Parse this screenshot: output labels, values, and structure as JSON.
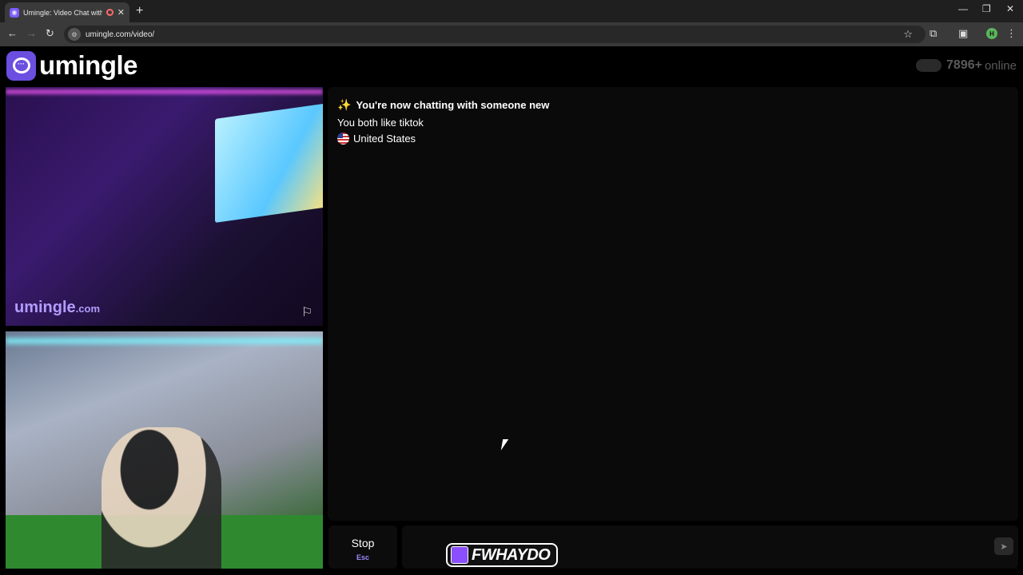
{
  "browser": {
    "tab_title": "Umingle: Video Chat with S",
    "url": "umingle.com/video/"
  },
  "header": {
    "logo_text": "umingle",
    "online_count": "7896+",
    "online_label": "online"
  },
  "stranger_video": {
    "watermark": "umingle",
    "watermark_domain": ".com"
  },
  "chat": {
    "messages": [
      "You're now chatting with someone new",
      "You both like tiktok",
      "United States"
    ]
  },
  "controls": {
    "stop_label": "Stop",
    "stop_key": "Esc"
  },
  "overlay": {
    "streamer_name": "FWHAYDO"
  },
  "colors": {
    "brand": "#6b4fe0",
    "accent_text": "#9d8bff"
  }
}
